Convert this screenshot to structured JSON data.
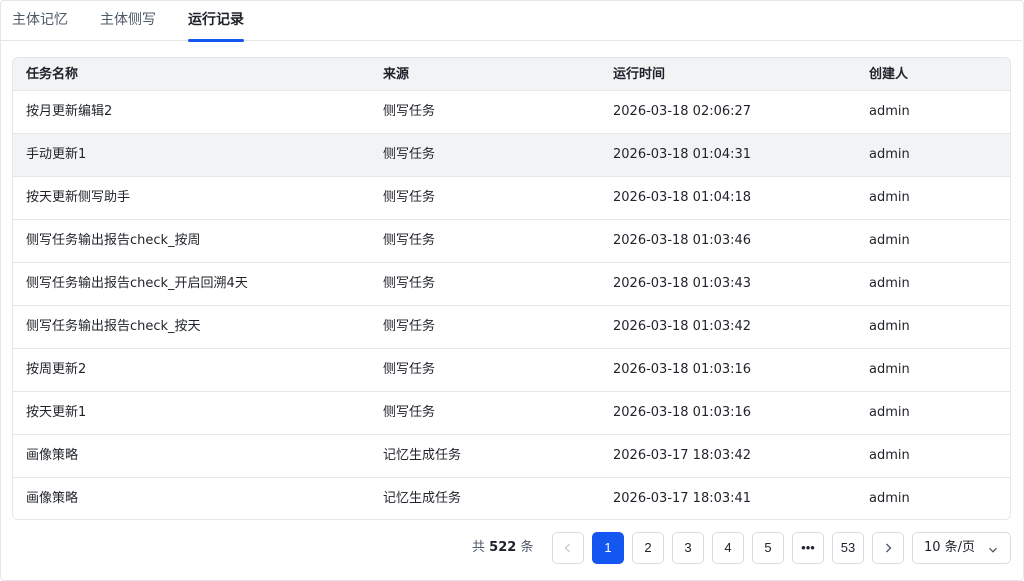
{
  "tabs": [
    {
      "label": "主体记忆"
    },
    {
      "label": "主体侧写"
    },
    {
      "label": "运行记录"
    }
  ],
  "active_tab": 2,
  "table": {
    "headers": [
      "任务名称",
      "来源",
      "运行时间",
      "创建人"
    ],
    "rows": [
      [
        "按月更新编辑2",
        "侧写任务",
        "2026-03-18 02:06:27",
        "admin"
      ],
      [
        "手动更新1",
        "侧写任务",
        "2026-03-18 01:04:31",
        "admin"
      ],
      [
        "按天更新侧写助手",
        "侧写任务",
        "2026-03-18 01:04:18",
        "admin"
      ],
      [
        "侧写任务输出报告check_按周",
        "侧写任务",
        "2026-03-18 01:03:46",
        "admin"
      ],
      [
        "侧写任务输出报告check_开启回溯4天",
        "侧写任务",
        "2026-03-18 01:03:43",
        "admin"
      ],
      [
        "侧写任务输出报告check_按天",
        "侧写任务",
        "2026-03-18 01:03:42",
        "admin"
      ],
      [
        "按周更新2",
        "侧写任务",
        "2026-03-18 01:03:16",
        "admin"
      ],
      [
        "按天更新1",
        "侧写任务",
        "2026-03-18 01:03:16",
        "admin"
      ],
      [
        "画像策略",
        "记忆生成任务",
        "2026-03-17 18:03:42",
        "admin"
      ],
      [
        "画像策略",
        "记忆生成任务",
        "2026-03-17 18:03:41",
        "admin"
      ]
    ]
  },
  "pagination": {
    "total_prefix": "共",
    "total_count": "522",
    "total_suffix": "条",
    "pages": [
      "1",
      "2",
      "3",
      "4",
      "5",
      "•••",
      "53"
    ],
    "current_page": "1",
    "page_size_label": "10 条/页"
  },
  "icons": {
    "prev": "chevron-left-icon",
    "next": "chevron-right-icon",
    "size_dropdown": "chevron-down-icon"
  },
  "colors": {
    "accent": "#1456f0",
    "header_bg": "#f2f3f5",
    "border": "#e5e6eb"
  }
}
